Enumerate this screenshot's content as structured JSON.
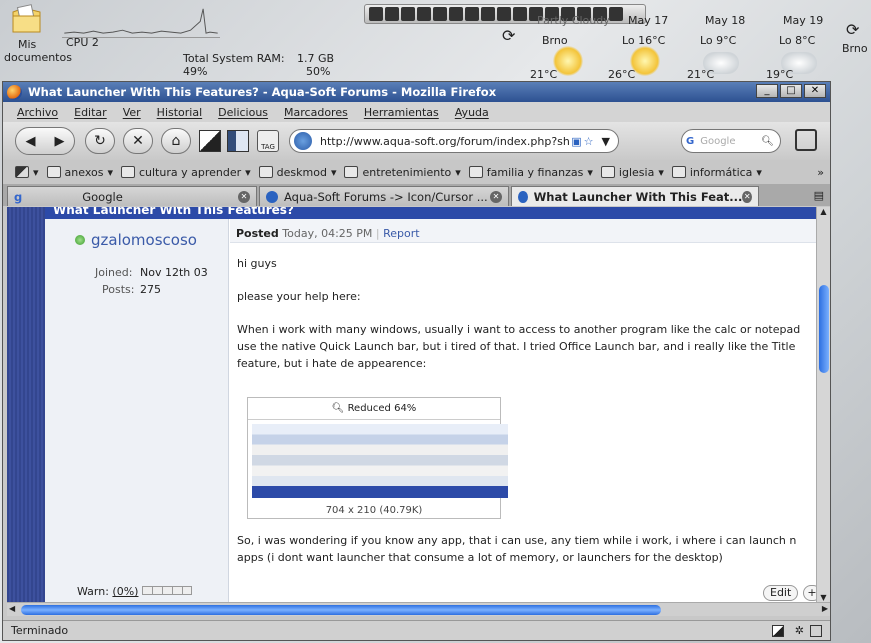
{
  "desktop": {
    "icon_label_line1": "Mis",
    "icon_label_line2": "documentos",
    "cpu_label": "CPU 2",
    "ram_label": "Total System RAM:",
    "ram_value": "1.7 GB",
    "cpu_percent": "49%",
    "ram_percent": "50%",
    "weather": {
      "condition": "Partly Cloudy",
      "city_left": "Brno",
      "city_right": "Brno",
      "days": [
        {
          "date": "May 17",
          "lo": "Lo 16°C",
          "temp": "26°C"
        },
        {
          "date": "May 18",
          "lo": "Lo 9°C",
          "temp": "21°C"
        },
        {
          "date": "May 19",
          "lo": "Lo 8°C",
          "temp": "19°C"
        }
      ],
      "current_temp": "21°C"
    }
  },
  "window": {
    "title": "What Launcher With This Features? - Aqua-Soft Forums - Mozilla Firefox",
    "controls": [
      "_",
      "□",
      "✕"
    ]
  },
  "menu": [
    "Archivo",
    "Editar",
    "Ver",
    "Historial",
    "Delicious",
    "Marcadores",
    "Herramientas",
    "Ayuda"
  ],
  "nav": {
    "url": "http://www.aqua-soft.org/forum/index.php?sh",
    "search_placeholder": "Google",
    "tag_label": "TAG"
  },
  "bookmarks": [
    "anexos",
    "cultura y aprender",
    "deskmod",
    "entretenimiento",
    "familia y finanzas",
    "iglesia",
    "informática"
  ],
  "tabs": [
    {
      "label": "Google",
      "active": false
    },
    {
      "label": "Aqua-Soft Forums -> Icon/Cursor ...",
      "active": false
    },
    {
      "label": "What Launcher With This Feat...",
      "active": true
    }
  ],
  "post": {
    "banner": "What Launcher With This Features?",
    "username": "gzalomoscoso",
    "joined_label": "Joined:",
    "joined_value": "Nov 12th 03",
    "posts_label": "Posts:",
    "posts_value": "275",
    "posted_label": "Posted",
    "posted_time": "Today, 04:25 PM",
    "separator": "|",
    "report": "Report",
    "lines": [
      "hi guys",
      "please your help here:",
      "When i work with many windows, usually i want to access to another program like the calc or notepad",
      "use the native Quick Launch bar, but i tired of that. I tried Office Launch bar, and i really like the Title",
      "feature, but i hate de appearence:"
    ],
    "thumb_title": "Reduced 64%",
    "thumb_caption": "704 x 210 (40.79K)",
    "lines2": [
      "So, i was wondering if you know any app, that i can use, any tiem while i work, i where i can launch n",
      "apps (i dont want launcher that consume a lot of memory, or launchers for the desktop)"
    ],
    "warn_label": "Warn:",
    "warn_value": "(0%)",
    "edit": "Edit",
    "plus": "+"
  },
  "status": "Terminado"
}
